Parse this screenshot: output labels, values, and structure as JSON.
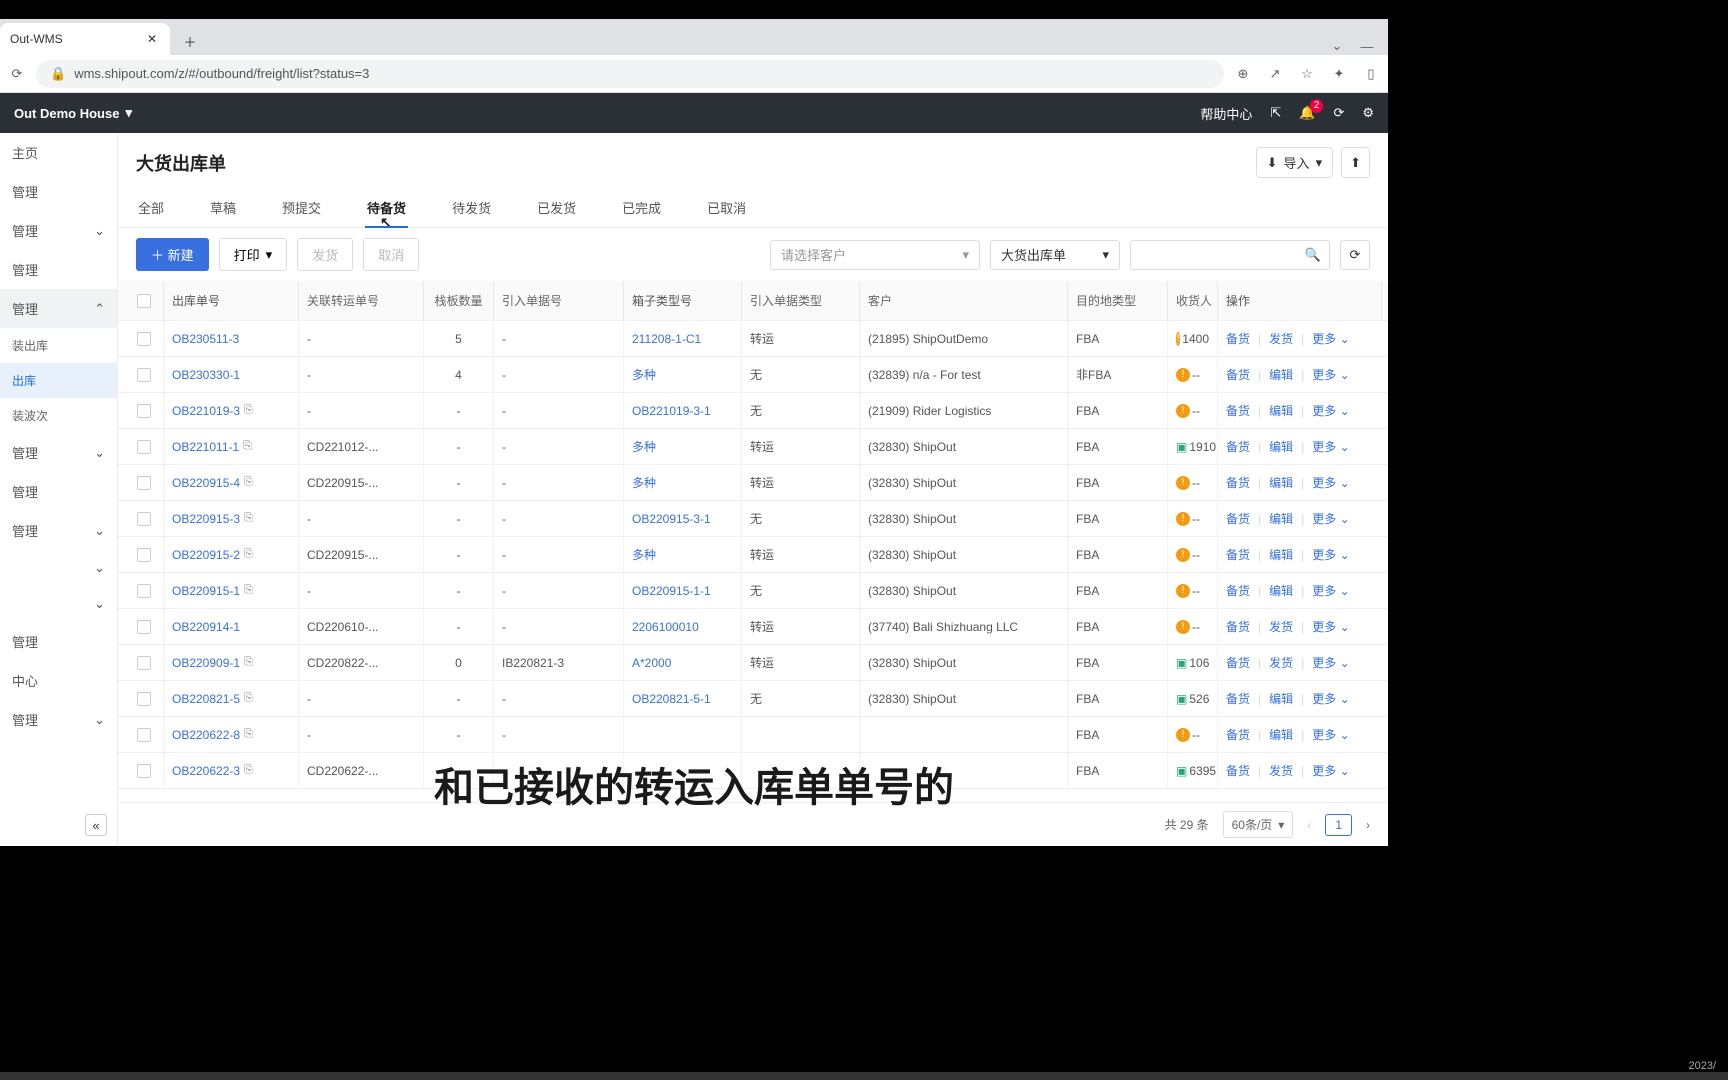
{
  "browser": {
    "tab_title": "Out-WMS",
    "url": "wms.shipout.com/z/#/outbound/freight/list?status=3"
  },
  "topbar": {
    "house": "Out Demo House",
    "help": "帮助中心",
    "notif_count": "2"
  },
  "sidebar": {
    "items": [
      {
        "label": "主页",
        "chev": false
      },
      {
        "label": "管理",
        "chev": false
      },
      {
        "label": "管理",
        "chev": true
      },
      {
        "label": "管理",
        "chev": false
      },
      {
        "label": "管理",
        "chev": true,
        "expanded": true,
        "subs": [
          {
            "label": "装出库"
          },
          {
            "label": "出库",
            "sel": true
          },
          {
            "label": "装波次"
          }
        ]
      },
      {
        "label": "管理",
        "chev": true
      },
      {
        "label": "管理",
        "chev": false
      },
      {
        "label": "管理",
        "chev": true
      },
      {
        "label": "",
        "chev": true
      },
      {
        "label": "",
        "chev": true
      },
      {
        "label": "管理",
        "chev": false
      },
      {
        "label": "中心",
        "chev": false
      },
      {
        "label": "管理",
        "chev": true
      }
    ]
  },
  "page": {
    "title": "大货出库单",
    "export": "导入",
    "tabs": [
      "全部",
      "草稿",
      "预提交",
      "待备货",
      "待发货",
      "已发货",
      "已完成",
      "已取消"
    ],
    "active_tab": 3,
    "toolbar": {
      "new": "新建",
      "print": "打印",
      "ship": "发货",
      "cancel": "取消",
      "cust_placeholder": "请选择客户",
      "type_value": "大货出库单"
    },
    "columns": [
      "",
      "出库单号",
      "关联转运单号",
      "栈板数量",
      "引入单据号",
      "箱子类型号",
      "引入单据类型",
      "客户",
      "目的地类型",
      "收货人",
      "操作"
    ],
    "rows": [
      {
        "num": "OB230511-3",
        "cp": false,
        "rel": "-",
        "pallet": "5",
        "refnum": "-",
        "box": "211208-1-C1",
        "reftype": "转运",
        "cust": "(21895) ShipOutDemo",
        "dest": "FBA",
        "recv_ico": "warn",
        "recv": "1400",
        "a1": "备货",
        "a2": "发货"
      },
      {
        "num": "OB230330-1",
        "cp": false,
        "rel": "-",
        "pallet": "4",
        "refnum": "-",
        "box": "多种",
        "reftype": "无",
        "cust": "(32839) n/a - For test",
        "dest": "非FBA",
        "recv_ico": "warn",
        "recv": "--",
        "a1": "备货",
        "a2": "编辑"
      },
      {
        "num": "OB221019-3",
        "cp": true,
        "rel": "-",
        "pallet": "-",
        "refnum": "-",
        "box": "OB221019-3-1",
        "reftype": "无",
        "cust": "(21909) Rider Logistics",
        "dest": "FBA",
        "recv_ico": "warn",
        "recv": "--",
        "a1": "备货",
        "a2": "编辑"
      },
      {
        "num": "OB221011-1",
        "cp": true,
        "rel": "CD221012-...",
        "pallet": "-",
        "refnum": "-",
        "box": "多种",
        "reftype": "转运",
        "cust": "(32830) ShipOut",
        "dest": "FBA",
        "recv_ico": "ok",
        "recv": "1910",
        "a1": "备货",
        "a2": "编辑"
      },
      {
        "num": "OB220915-4",
        "cp": true,
        "rel": "CD220915-...",
        "pallet": "-",
        "refnum": "-",
        "box": "多种",
        "reftype": "转运",
        "cust": "(32830) ShipOut",
        "dest": "FBA",
        "recv_ico": "warn",
        "recv": "--",
        "a1": "备货",
        "a2": "编辑"
      },
      {
        "num": "OB220915-3",
        "cp": true,
        "rel": "-",
        "pallet": "-",
        "refnum": "-",
        "box": "OB220915-3-1",
        "reftype": "无",
        "cust": "(32830) ShipOut",
        "dest": "FBA",
        "recv_ico": "warn",
        "recv": "--",
        "a1": "备货",
        "a2": "编辑"
      },
      {
        "num": "OB220915-2",
        "cp": true,
        "rel": "CD220915-...",
        "pallet": "-",
        "refnum": "-",
        "box": "多种",
        "reftype": "转运",
        "cust": "(32830) ShipOut",
        "dest": "FBA",
        "recv_ico": "warn",
        "recv": "--",
        "a1": "备货",
        "a2": "编辑"
      },
      {
        "num": "OB220915-1",
        "cp": true,
        "rel": "-",
        "pallet": "-",
        "refnum": "-",
        "box": "OB220915-1-1",
        "reftype": "无",
        "cust": "(32830) ShipOut",
        "dest": "FBA",
        "recv_ico": "warn",
        "recv": "--",
        "a1": "备货",
        "a2": "编辑"
      },
      {
        "num": "OB220914-1",
        "cp": false,
        "rel": "CD220610-...",
        "pallet": "-",
        "refnum": "-",
        "box": "2206100010",
        "reftype": "转运",
        "cust": "(37740) Bali Shizhuang LLC",
        "dest": "FBA",
        "recv_ico": "warn",
        "recv": "--",
        "a1": "备货",
        "a2": "发货"
      },
      {
        "num": "OB220909-1",
        "cp": true,
        "rel": "CD220822-...",
        "pallet": "0",
        "refnum": "IB220821-3",
        "box": "A*2000",
        "reftype": "转运",
        "cust": "(32830) ShipOut",
        "dest": "FBA",
        "recv_ico": "ok",
        "recv": "106",
        "a1": "备货",
        "a2": "发货"
      },
      {
        "num": "OB220821-5",
        "cp": true,
        "rel": "-",
        "pallet": "-",
        "refnum": "-",
        "box": "OB220821-5-1",
        "reftype": "无",
        "cust": "(32830) ShipOut",
        "dest": "FBA",
        "recv_ico": "ok",
        "recv": "526",
        "a1": "备货",
        "a2": "编辑"
      },
      {
        "num": "OB220622-8",
        "cp": true,
        "rel": "-",
        "pallet": "-",
        "refnum": "-",
        "box": "",
        "reftype": "",
        "cust": "",
        "dest": "FBA",
        "recv_ico": "warn",
        "recv": "--",
        "a1": "备货",
        "a2": "编辑"
      },
      {
        "num": "OB220622-3",
        "cp": true,
        "rel": "CD220622-...",
        "pallet": "",
        "refnum": "",
        "box": "",
        "reftype": "",
        "cust": "",
        "dest": "FBA",
        "recv_ico": "ok",
        "recv": "6395",
        "a1": "备货",
        "a2": "发货"
      }
    ],
    "more": "更多",
    "pager": {
      "total": "共 29 条",
      "size": "60条/页",
      "page": "1"
    }
  },
  "subtitle": "和已接收的转运入库单单号的",
  "footer_date": "2023/"
}
